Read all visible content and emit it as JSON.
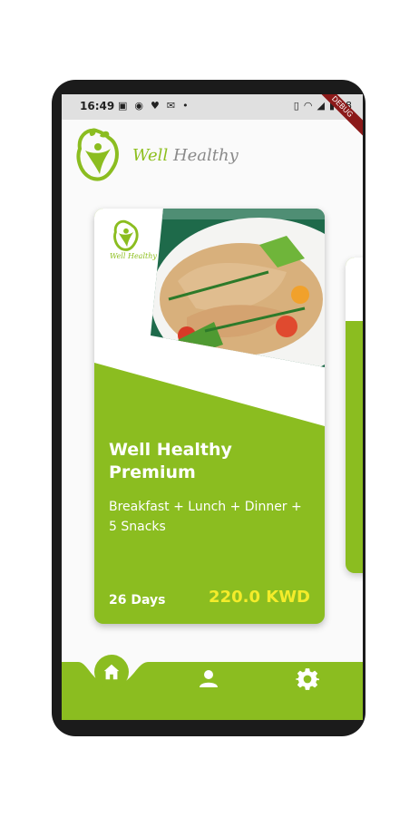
{
  "status_bar": {
    "time": "16:49",
    "left_icons": [
      "sim-icon",
      "pinterest-icon",
      "heart-icon",
      "gmail-icon",
      "dot-icon"
    ],
    "right_icons": [
      "vibrate-icon",
      "wifi-icon",
      "signal-icon",
      "battery-icon"
    ],
    "battery": "68",
    "debug_banner": "DEBUG"
  },
  "header": {
    "brand_first": "Well",
    "brand_second": "Healthy"
  },
  "card": {
    "logo_text": "Well Healthy",
    "title": "Well Healthy Premium",
    "meals": "Breakfast + Lunch + Dinner + 5 Snacks",
    "days": "26 Days",
    "price": "220.0 KWD"
  },
  "bottom_nav": {
    "items": [
      {
        "name": "home",
        "icon": "home-icon",
        "active": true
      },
      {
        "name": "profile",
        "icon": "person-icon",
        "active": false
      },
      {
        "name": "settings",
        "icon": "gear-icon",
        "active": false
      }
    ]
  },
  "colors": {
    "brand_green": "#8bbd20",
    "price_yellow": "#f4ec2a",
    "brand_gray": "#8a8a8a"
  }
}
